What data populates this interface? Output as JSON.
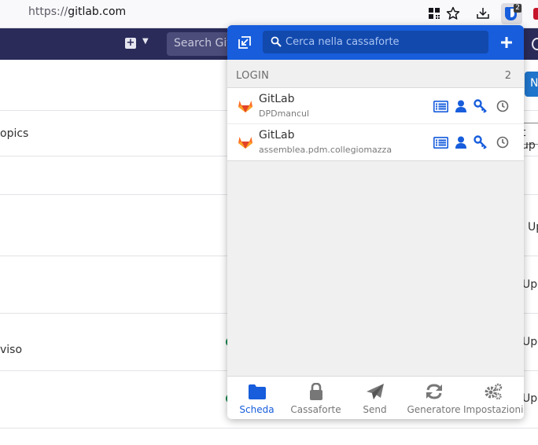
{
  "browser": {
    "url_scheme": "https://",
    "url_host": "gitlab.com",
    "extension_badge": "2"
  },
  "gitlab_bg": {
    "search_placeholder": "Search Git",
    "button_partial": "N",
    "input_partial": "t up",
    "row_texts": [
      "opics",
      "viso"
    ],
    "right_texts": [
      "Up",
      "Upd",
      "Upd",
      "Upd"
    ]
  },
  "popup": {
    "search": {
      "placeholder": "Cerca nella cassaforte",
      "value": ""
    },
    "section": {
      "label": "LOGIN",
      "count": "2"
    },
    "items": [
      {
        "name": "GitLab",
        "subtitle": "DPDmancul"
      },
      {
        "name": "GitLab",
        "subtitle": "assemblea.pdm.collegiomazza"
      }
    ],
    "tabs": [
      {
        "label": "Scheda",
        "icon": "folder-icon",
        "active": true
      },
      {
        "label": "Cassaforte",
        "icon": "lock-icon",
        "active": false
      },
      {
        "label": "Send",
        "icon": "paper-plane-icon",
        "active": false
      },
      {
        "label": "Generatore",
        "icon": "refresh-icon",
        "active": false
      },
      {
        "label": "Impostazioni",
        "icon": "gears-icon",
        "active": false
      }
    ],
    "colors": {
      "brand": "#175ddc",
      "gitlab_orange": "#fc6d26"
    }
  }
}
